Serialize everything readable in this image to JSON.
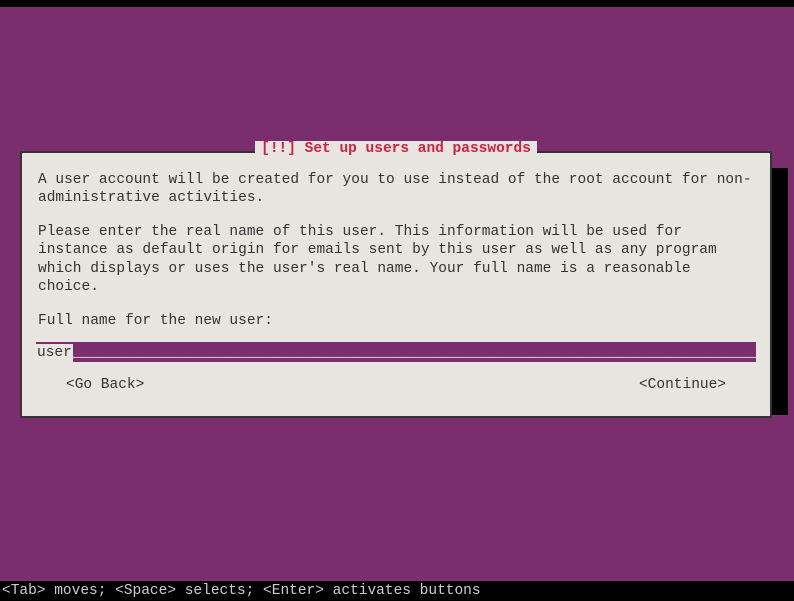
{
  "dialog": {
    "title": "[!!] Set up users and passwords",
    "para1": "A user account will be created for you to use instead of the root account for non-administrative activities.",
    "para2": "Please enter the real name of this user. This information will be used for instance as default origin for emails sent by this user as well as any program which displays or uses the user's real name. Your full name is a reasonable choice.",
    "fieldLabel": "Full name for the new user:",
    "fieldValue": "user",
    "fillerUnderscore": "___________________________________________________________________________________",
    "goBack": "<Go Back>",
    "continue": "<Continue>"
  },
  "footer": "<Tab> moves; <Space> selects; <Enter> activates buttons"
}
